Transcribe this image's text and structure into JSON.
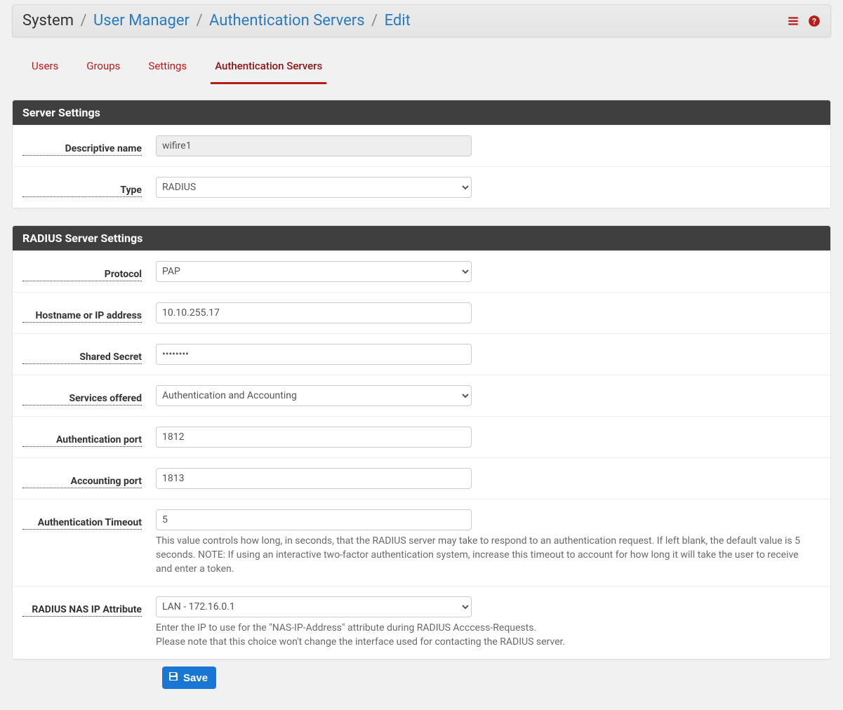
{
  "breadcrumb": {
    "root": "System",
    "level1": "User Manager",
    "level2": "Authentication Servers",
    "level3": "Edit"
  },
  "tabs": {
    "users": "Users",
    "groups": "Groups",
    "settings": "Settings",
    "authservers": "Authentication Servers"
  },
  "panel1": {
    "title": "Server Settings",
    "name_label": "Descriptive name",
    "name_value": "wifire1",
    "type_label": "Type",
    "type_value": "RADIUS"
  },
  "panel2": {
    "title": "RADIUS Server Settings",
    "protocol_label": "Protocol",
    "protocol_value": "PAP",
    "host_label": "Hostname or IP address",
    "host_value": "10.10.255.17",
    "secret_label": "Shared Secret",
    "secret_value": "••••••••",
    "services_label": "Services offered",
    "services_value": "Authentication and Accounting",
    "authport_label": "Authentication port",
    "authport_value": "1812",
    "acctport_label": "Accounting port",
    "acctport_value": "1813",
    "timeout_label": "Authentication Timeout",
    "timeout_value": "5",
    "timeout_help": "This value controls how long, in seconds, that the RADIUS server may take to respond to an authentication request. If left blank, the default value is 5 seconds. NOTE: If using an interactive two-factor authentication system, increase this timeout to account for how long it will take the user to receive and enter a token.",
    "nasip_label": "RADIUS NAS IP Attribute",
    "nasip_value": "LAN - 172.16.0.1",
    "nasip_help1": "Enter the IP to use for the \"NAS-IP-Address\" attribute during RADIUS Acccess-Requests.",
    "nasip_help2": "Please note that this choice won't change the interface used for contacting the RADIUS server."
  },
  "actions": {
    "save_label": "Save"
  }
}
